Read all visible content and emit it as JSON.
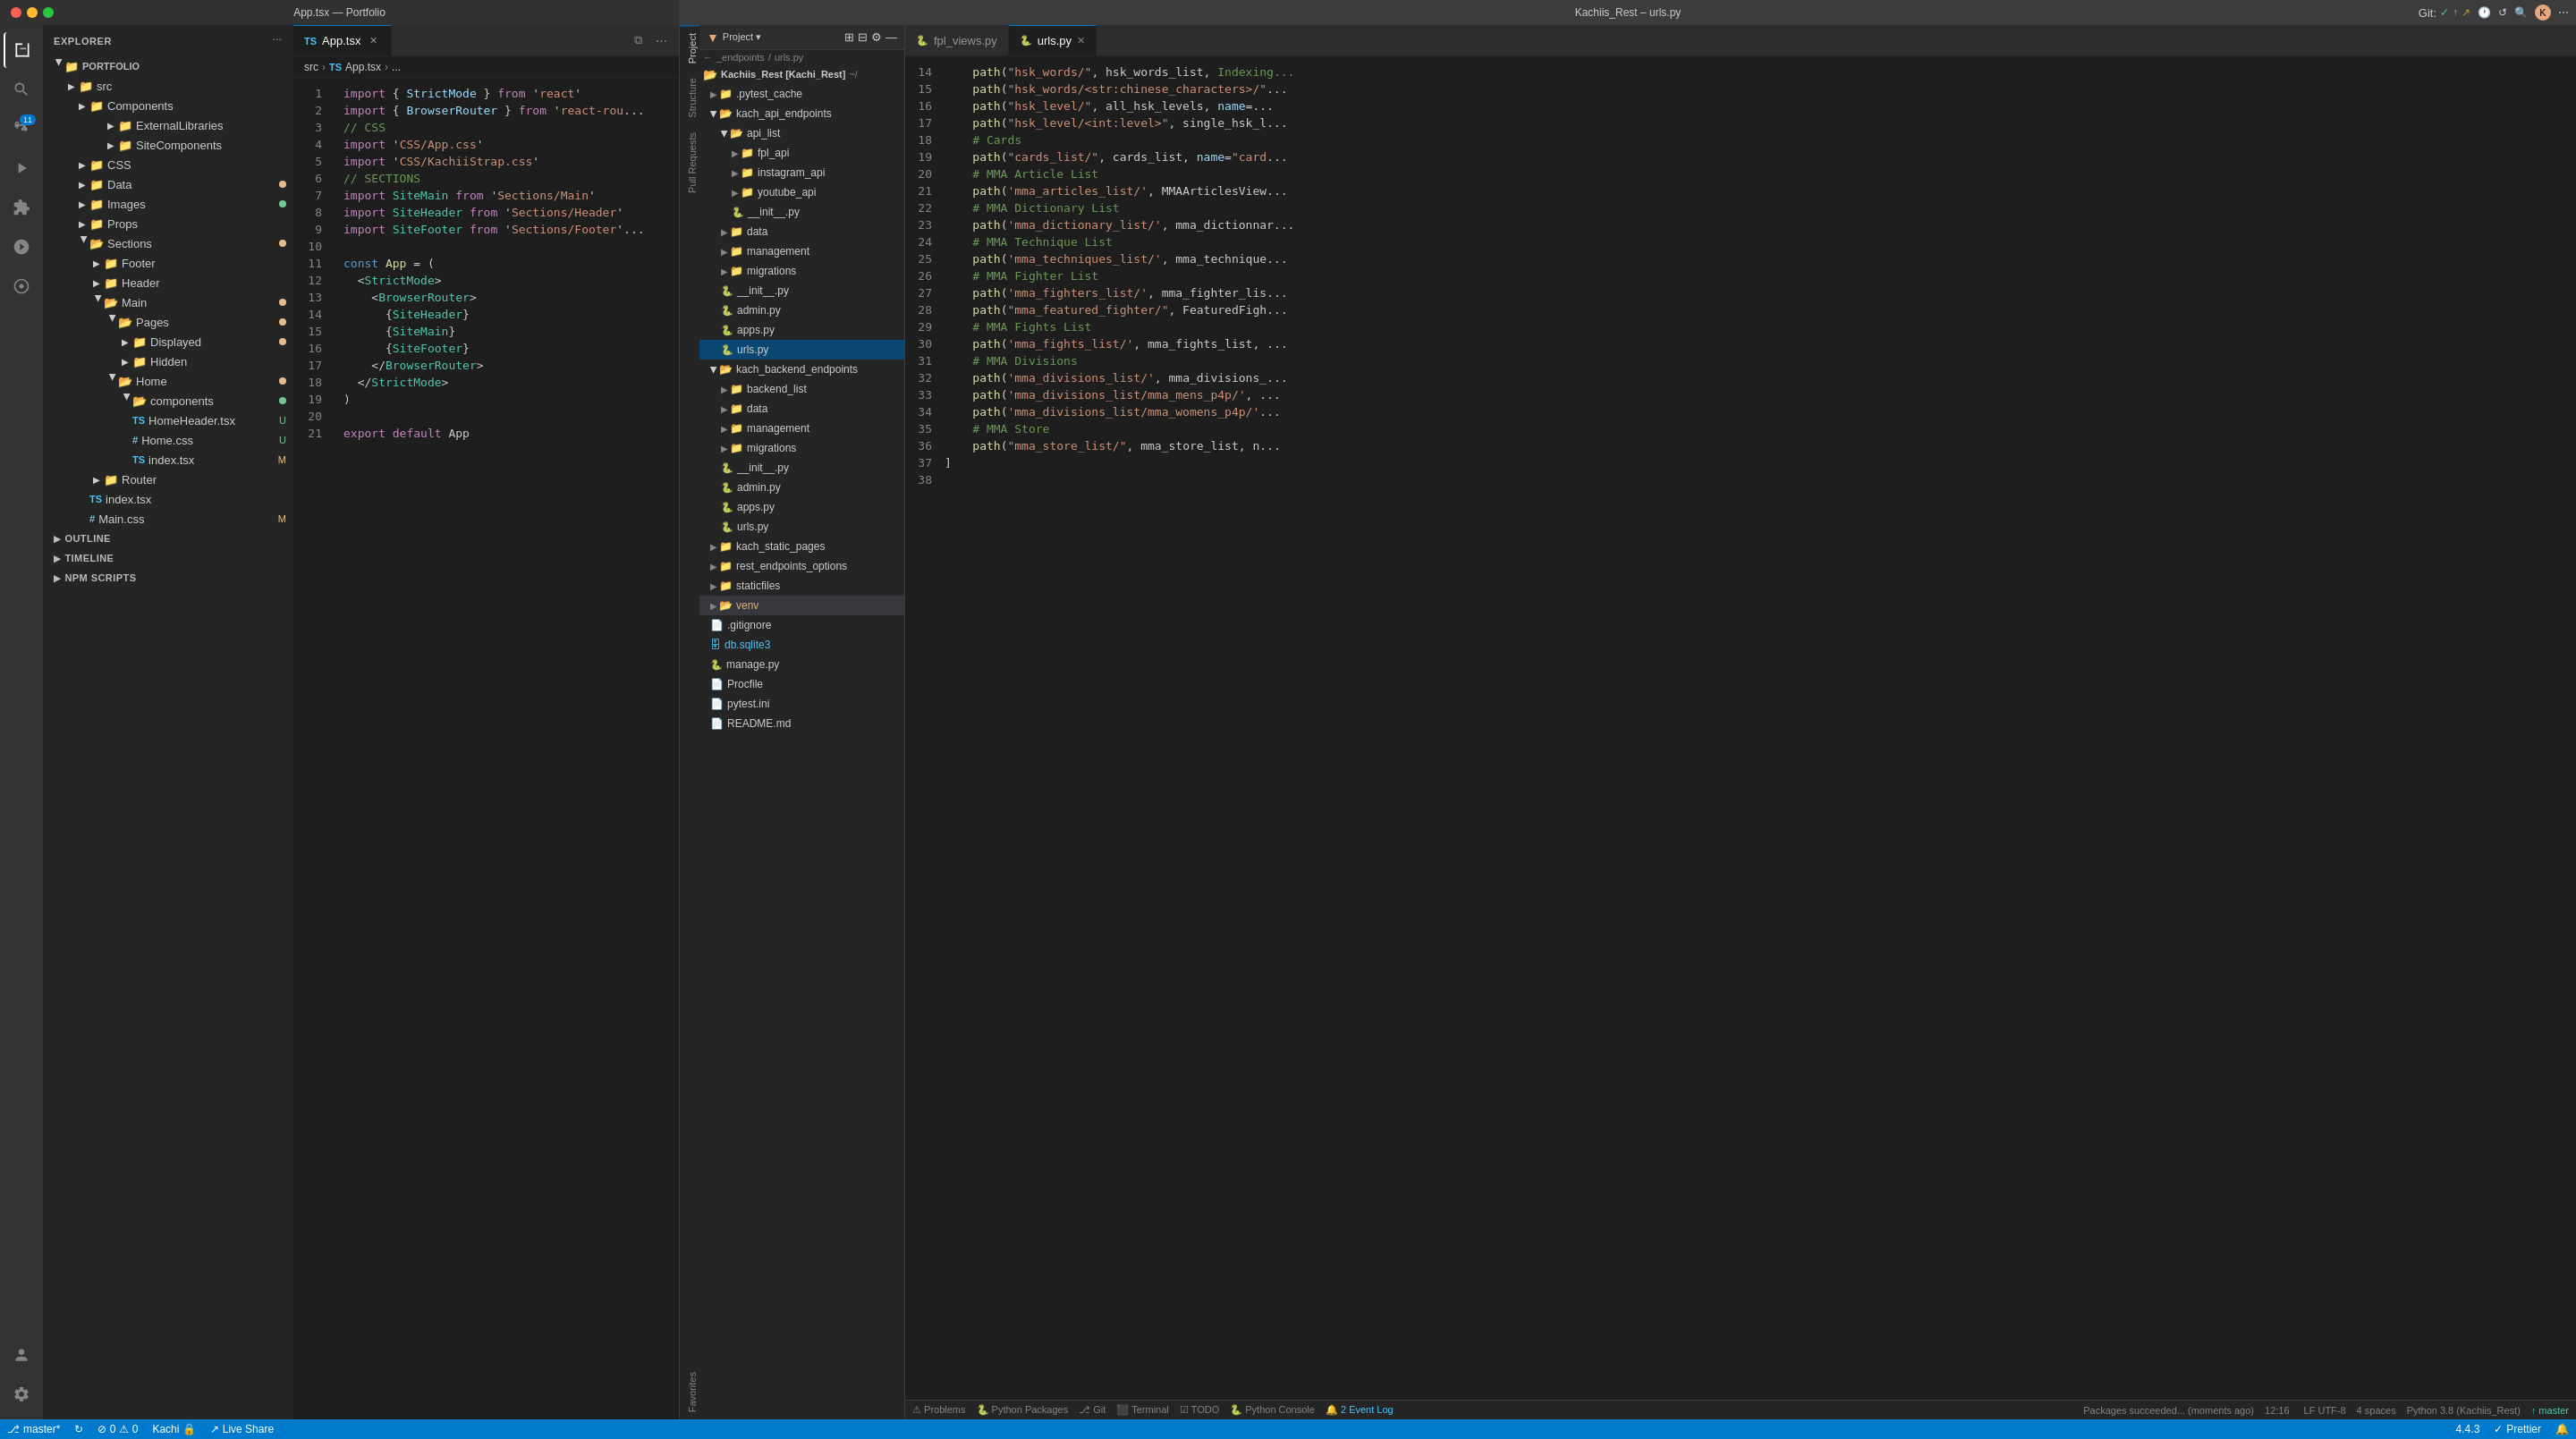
{
  "leftTitle": "App.tsx — Portfolio",
  "rightTitle": "Kachiis_Rest – urls.py",
  "leftEditor": {
    "filename": "App.tsx",
    "breadcrumb": [
      "src",
      "App.tsx",
      "..."
    ],
    "lines": [
      {
        "num": 1,
        "tokens": [
          {
            "t": "import",
            "c": "kw"
          },
          {
            "t": " { ",
            "c": ""
          },
          {
            "t": "StrictMode",
            "c": "imp"
          },
          {
            "t": " } ",
            "c": ""
          },
          {
            "t": "from",
            "c": "kw"
          },
          {
            "t": " '",
            "c": ""
          },
          {
            "t": "react",
            "c": "str"
          },
          {
            "t": "'",
            "c": ""
          }
        ]
      },
      {
        "num": 2,
        "tokens": [
          {
            "t": "import",
            "c": "kw"
          },
          {
            "t": " { ",
            "c": ""
          },
          {
            "t": "BrowserRouter",
            "c": "imp"
          },
          {
            "t": " } ",
            "c": ""
          },
          {
            "t": "from",
            "c": "kw"
          },
          {
            "t": " '",
            "c": ""
          },
          {
            "t": "react-rou",
            "c": "str"
          },
          {
            "t": "...",
            "c": "str"
          }
        ]
      },
      {
        "num": 3,
        "tokens": [
          {
            "t": "// CSS",
            "c": "cmt"
          }
        ]
      },
      {
        "num": 4,
        "tokens": [
          {
            "t": "import",
            "c": "kw"
          },
          {
            "t": " '",
            "c": ""
          },
          {
            "t": "CSS/App.css",
            "c": "str"
          },
          {
            "t": "'",
            "c": ""
          }
        ]
      },
      {
        "num": 5,
        "tokens": [
          {
            "t": "import",
            "c": "kw"
          },
          {
            "t": " '",
            "c": ""
          },
          {
            "t": "CSS/KachiiStrap.css",
            "c": "str"
          },
          {
            "t": "'",
            "c": ""
          }
        ]
      },
      {
        "num": 6,
        "tokens": [
          {
            "t": "// SECTIONS",
            "c": "cmt"
          }
        ]
      },
      {
        "num": 7,
        "tokens": [
          {
            "t": "import",
            "c": "kw"
          },
          {
            "t": " ",
            "c": ""
          },
          {
            "t": "SiteMain",
            "c": "cls"
          },
          {
            "t": " ",
            "c": ""
          },
          {
            "t": "from",
            "c": "kw"
          },
          {
            "t": " '",
            "c": ""
          },
          {
            "t": "Sections/Main",
            "c": "str"
          },
          {
            "t": "'",
            "c": ""
          }
        ]
      },
      {
        "num": 8,
        "tokens": [
          {
            "t": "import",
            "c": "kw"
          },
          {
            "t": " ",
            "c": ""
          },
          {
            "t": "SiteHeader",
            "c": "cls"
          },
          {
            "t": " ",
            "c": ""
          },
          {
            "t": "from",
            "c": "kw"
          },
          {
            "t": " '",
            "c": ""
          },
          {
            "t": "Sections/Header",
            "c": "str"
          },
          {
            "t": "'",
            "c": ""
          }
        ]
      },
      {
        "num": 9,
        "tokens": [
          {
            "t": "import",
            "c": "kw"
          },
          {
            "t": " ",
            "c": ""
          },
          {
            "t": "SiteFooter",
            "c": "cls"
          },
          {
            "t": " ",
            "c": ""
          },
          {
            "t": "from",
            "c": "kw"
          },
          {
            "t": " '",
            "c": ""
          },
          {
            "t": "Sections/Footer",
            "c": "str"
          },
          {
            "t": "...",
            "c": "str"
          }
        ]
      },
      {
        "num": 10,
        "tokens": []
      },
      {
        "num": 11,
        "tokens": [
          {
            "t": "const",
            "c": "kw2"
          },
          {
            "t": " ",
            "c": ""
          },
          {
            "t": "App",
            "c": "fn"
          },
          {
            "t": " = (",
            "c": ""
          }
        ]
      },
      {
        "num": 12,
        "tokens": [
          {
            "t": "  ",
            "c": ""
          },
          {
            "t": "<",
            "c": ""
          },
          {
            "t": "StrictMode",
            "c": "tag"
          },
          {
            "t": ">",
            "c": ""
          }
        ]
      },
      {
        "num": 13,
        "tokens": [
          {
            "t": "    ",
            "c": ""
          },
          {
            "t": "<",
            "c": ""
          },
          {
            "t": "BrowserRouter",
            "c": "tag"
          },
          {
            "t": ">",
            "c": ""
          }
        ]
      },
      {
        "num": 14,
        "tokens": [
          {
            "t": "      ",
            "c": ""
          },
          {
            "t": "{",
            "c": ""
          },
          {
            "t": "SiteHeader",
            "c": "cls"
          },
          {
            "t": "}",
            "c": ""
          }
        ]
      },
      {
        "num": 15,
        "tokens": [
          {
            "t": "      ",
            "c": ""
          },
          {
            "t": "{",
            "c": ""
          },
          {
            "t": "SiteMain",
            "c": "cls"
          },
          {
            "t": "}",
            "c": ""
          }
        ]
      },
      {
        "num": 16,
        "tokens": [
          {
            "t": "      ",
            "c": ""
          },
          {
            "t": "{",
            "c": ""
          },
          {
            "t": "SiteFooter",
            "c": "cls"
          },
          {
            "t": "}",
            "c": ""
          }
        ]
      },
      {
        "num": 17,
        "tokens": [
          {
            "t": "    ",
            "c": ""
          },
          {
            "t": "</",
            "c": ""
          },
          {
            "t": "BrowserRouter",
            "c": "tag"
          },
          {
            "t": ">",
            "c": ""
          }
        ]
      },
      {
        "num": 18,
        "tokens": [
          {
            "t": "  ",
            "c": ""
          },
          {
            "t": "</",
            "c": ""
          },
          {
            "t": "StrictMode",
            "c": "tag"
          },
          {
            "t": ">",
            "c": ""
          }
        ]
      },
      {
        "num": 19,
        "tokens": [
          {
            "t": ")",
            "c": ""
          }
        ]
      },
      {
        "num": 20,
        "tokens": []
      },
      {
        "num": 21,
        "tokens": [
          {
            "t": "export",
            "c": "kw"
          },
          {
            "t": " ",
            "c": ""
          },
          {
            "t": "default",
            "c": "kw"
          },
          {
            "t": " App",
            "c": ""
          }
        ]
      }
    ]
  },
  "rightEditor": {
    "filename": "urls.py",
    "startLine": 14,
    "lines": [
      {
        "num": 14,
        "code": "    path(\"hsk_words/\", hsk_words_list, Indexing..."
      },
      {
        "num": 15,
        "code": "    path(\"hsk_words/<str:chinese_characters>/\"..."
      },
      {
        "num": 16,
        "code": "    path(\"hsk_level/\", all_hsk_levels, name=..."
      },
      {
        "num": 17,
        "code": "    path(\"hsk_level/<int:level>\", single_hsk_l..."
      },
      {
        "num": 18,
        "code": "    # Cards"
      },
      {
        "num": 19,
        "code": "    path(\"cards_list/\", cards_list, name=\"card..."
      },
      {
        "num": 20,
        "code": "    # MMA Article List"
      },
      {
        "num": 21,
        "code": "    path('mma_articles_list/', MMAArticlesView..."
      },
      {
        "num": 22,
        "code": "    # MMA Dictionary List"
      },
      {
        "num": 23,
        "code": "    path('mma_dictionary_list/', mma_dictionnar..."
      },
      {
        "num": 24,
        "code": "    # MMA Technique List"
      },
      {
        "num": 25,
        "code": "    path('mma_techniques_list/', mma_technique..."
      },
      {
        "num": 26,
        "code": "    # MMA Fighter List"
      },
      {
        "num": 27,
        "code": "    path('mma_fighters_list/', mma_fighter_lis..."
      },
      {
        "num": 28,
        "code": "    path(\"mma_featured_fighter/\", FeaturedFigh..."
      },
      {
        "num": 29,
        "code": "    # MMA Fights List"
      },
      {
        "num": 30,
        "code": "    path('mma_fights_list/', mma_fights_list, ..."
      },
      {
        "num": 31,
        "code": "    # MMA Divisions"
      },
      {
        "num": 32,
        "code": "    path('mma_divisions_list/', mma_divisions_..."
      },
      {
        "num": 33,
        "code": "    path('mma_divisions_list/mma_mens_p4p/', ..."
      },
      {
        "num": 34,
        "code": "    path('mma_divisions_list/mma_womens_p4p/'..."
      },
      {
        "num": 35,
        "code": "    # MMA Store"
      },
      {
        "num": 36,
        "code": "    path(\"mma_store_list/\", mma_store_list, n..."
      },
      {
        "num": 37,
        "code": "]"
      },
      {
        "num": 38,
        "code": ""
      }
    ]
  },
  "sidebar": {
    "title": "EXPLORER",
    "rootLabel": "PORTFOLIO",
    "items": [
      {
        "label": "Components",
        "type": "folder",
        "indent": 1,
        "expanded": true,
        "arrow": "▶"
      },
      {
        "label": "ExternalLibraries",
        "type": "folder",
        "indent": 2,
        "expanded": false,
        "arrow": "▶"
      },
      {
        "label": "SiteComponents",
        "type": "folder",
        "indent": 2,
        "expanded": false,
        "arrow": "▶"
      },
      {
        "label": "CSS",
        "type": "folder",
        "indent": 1,
        "expanded": false,
        "arrow": "▶"
      },
      {
        "label": "Data",
        "type": "folder",
        "indent": 1,
        "expanded": false,
        "arrow": "▶",
        "badge": "yellow"
      },
      {
        "label": "Images",
        "type": "folder",
        "indent": 1,
        "expanded": false,
        "arrow": "▶",
        "badge": "green"
      },
      {
        "label": "Props",
        "type": "folder",
        "indent": 1,
        "expanded": false,
        "arrow": "▶"
      },
      {
        "label": "Sections",
        "type": "folder",
        "indent": 1,
        "expanded": true,
        "arrow": "▼",
        "badge": "yellow"
      },
      {
        "label": "Footer",
        "type": "folder",
        "indent": 2,
        "expanded": false,
        "arrow": "▶"
      },
      {
        "label": "Header",
        "type": "folder",
        "indent": 2,
        "expanded": false,
        "arrow": "▶"
      },
      {
        "label": "Main",
        "type": "folder",
        "indent": 2,
        "expanded": true,
        "arrow": "▼",
        "badge": "yellow"
      },
      {
        "label": "Pages",
        "type": "folder",
        "indent": 3,
        "expanded": true,
        "arrow": "▼",
        "badge": "yellow"
      },
      {
        "label": "Displayed",
        "type": "folder",
        "indent": 4,
        "expanded": false,
        "arrow": "▶",
        "badge": "yellow"
      },
      {
        "label": "Hidden",
        "type": "folder",
        "indent": 4,
        "expanded": false,
        "arrow": "▶"
      },
      {
        "label": "Home",
        "type": "folder",
        "indent": 3,
        "expanded": true,
        "arrow": "▼",
        "badge": "yellow"
      },
      {
        "label": "components",
        "type": "folder",
        "indent": 4,
        "expanded": true,
        "arrow": "▼",
        "badge": "green"
      },
      {
        "label": "HomeHeader.tsx",
        "type": "ts",
        "indent": 5,
        "label2": "U"
      },
      {
        "label": "Home.css",
        "type": "css",
        "indent": 5,
        "label2": "U"
      },
      {
        "label": "index.tsx",
        "type": "ts",
        "indent": 5,
        "label2": "M"
      },
      {
        "label": "Router",
        "type": "folder",
        "indent": 2,
        "expanded": false,
        "arrow": "▶"
      },
      {
        "label": "index.tsx",
        "type": "ts",
        "indent": 2
      },
      {
        "label": "Main.css",
        "type": "css",
        "indent": 2,
        "label2": "M"
      }
    ],
    "sections": [
      {
        "label": "OUTLINE"
      },
      {
        "label": "TIMELINE"
      },
      {
        "label": "NPM SCRIPTS"
      }
    ]
  },
  "rightSidebar": {
    "breadcrumb": "_endpoints  /  urls.py",
    "projectLabel": "Project",
    "root": "Kachiis_Rest [Kachi_Rest]",
    "items": [
      {
        "label": ".pytest_cache",
        "type": "folder",
        "indent": 1
      },
      {
        "label": "kach_api_endpoints",
        "type": "folder",
        "indent": 1,
        "expanded": true
      },
      {
        "label": "api_list",
        "type": "folder",
        "indent": 2,
        "expanded": true
      },
      {
        "label": "fpl_api",
        "type": "folder",
        "indent": 3
      },
      {
        "label": "instagram_api",
        "type": "folder",
        "indent": 3
      },
      {
        "label": "youtube_api",
        "type": "folder",
        "indent": 3
      },
      {
        "label": "__init__.py",
        "type": "py",
        "indent": 3
      },
      {
        "label": "data",
        "type": "folder",
        "indent": 2
      },
      {
        "label": "management",
        "type": "folder",
        "indent": 2
      },
      {
        "label": "migrations",
        "type": "folder",
        "indent": 2
      },
      {
        "label": "__init__.py",
        "type": "py",
        "indent": 2
      },
      {
        "label": "admin.py",
        "type": "py",
        "indent": 2
      },
      {
        "label": "apps.py",
        "type": "py",
        "indent": 2
      },
      {
        "label": "urls.py",
        "type": "py",
        "indent": 2,
        "selected": true
      },
      {
        "label": "kach_backend_endpoints",
        "type": "folder",
        "indent": 1,
        "expanded": true
      },
      {
        "label": "backend_list",
        "type": "folder",
        "indent": 2
      },
      {
        "label": "data",
        "type": "folder",
        "indent": 2
      },
      {
        "label": "management",
        "type": "folder",
        "indent": 2
      },
      {
        "label": "migrations",
        "type": "folder",
        "indent": 2
      },
      {
        "label": "__init__.py",
        "type": "py",
        "indent": 2
      },
      {
        "label": "admin.py",
        "type": "py",
        "indent": 2
      },
      {
        "label": "apps.py",
        "type": "py",
        "indent": 2
      },
      {
        "label": "urls.py",
        "type": "py",
        "indent": 2
      },
      {
        "label": "kach_static_pages",
        "type": "folder",
        "indent": 1
      },
      {
        "label": "rest_endpoints_options",
        "type": "folder",
        "indent": 1
      },
      {
        "label": "staticfiles",
        "type": "folder",
        "indent": 1
      },
      {
        "label": "venv",
        "type": "folder",
        "indent": 1,
        "highlighted": true
      },
      {
        "label": ".gitignore",
        "type": "file",
        "indent": 1
      },
      {
        "label": "db.sqlite3",
        "type": "db",
        "indent": 1
      },
      {
        "label": "manage.py",
        "type": "py",
        "indent": 1
      },
      {
        "label": "Procfile",
        "type": "file",
        "indent": 1
      },
      {
        "label": "pytest.ini",
        "type": "file",
        "indent": 1
      },
      {
        "label": "README.md",
        "type": "file",
        "indent": 1
      }
    ]
  },
  "statusBar": {
    "left": {
      "branch": "master*",
      "sync": "↻",
      "errors": "⊘ 0",
      "warnings": "⚠ 0",
      "user": "Kachi 🔒"
    },
    "right": {
      "liveShare": "Live Share",
      "version": "4.4.3",
      "prettier": "Prettier"
    }
  },
  "rightStatusBar": {
    "packages": "Packages succeeded... (moments ago)",
    "time": "12:16",
    "encoding": "LF  UTF-8",
    "spaces": "4 spaces",
    "python": "Python 3.8 (Kachiis_Rest)",
    "branch": "↑ master"
  }
}
